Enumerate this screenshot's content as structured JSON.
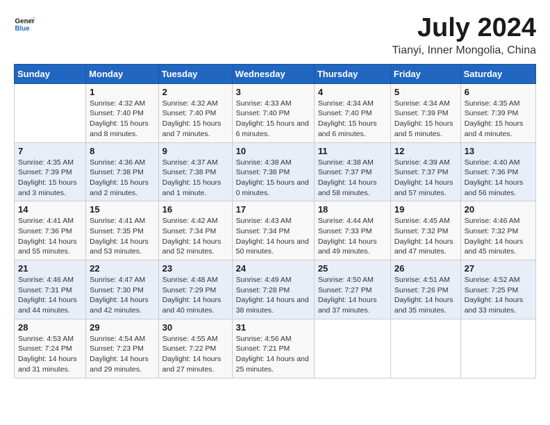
{
  "logo": {
    "line1": "General",
    "line2": "Blue"
  },
  "title": "July 2024",
  "subtitle": "Tianyi, Inner Mongolia, China",
  "headers": [
    "Sunday",
    "Monday",
    "Tuesday",
    "Wednesday",
    "Thursday",
    "Friday",
    "Saturday"
  ],
  "weeks": [
    [
      {
        "day": "",
        "sunrise": "",
        "sunset": "",
        "daylight": ""
      },
      {
        "day": "1",
        "sunrise": "Sunrise: 4:32 AM",
        "sunset": "Sunset: 7:40 PM",
        "daylight": "Daylight: 15 hours and 8 minutes."
      },
      {
        "day": "2",
        "sunrise": "Sunrise: 4:32 AM",
        "sunset": "Sunset: 7:40 PM",
        "daylight": "Daylight: 15 hours and 7 minutes."
      },
      {
        "day": "3",
        "sunrise": "Sunrise: 4:33 AM",
        "sunset": "Sunset: 7:40 PM",
        "daylight": "Daylight: 15 hours and 6 minutes."
      },
      {
        "day": "4",
        "sunrise": "Sunrise: 4:34 AM",
        "sunset": "Sunset: 7:40 PM",
        "daylight": "Daylight: 15 hours and 6 minutes."
      },
      {
        "day": "5",
        "sunrise": "Sunrise: 4:34 AM",
        "sunset": "Sunset: 7:39 PM",
        "daylight": "Daylight: 15 hours and 5 minutes."
      },
      {
        "day": "6",
        "sunrise": "Sunrise: 4:35 AM",
        "sunset": "Sunset: 7:39 PM",
        "daylight": "Daylight: 15 hours and 4 minutes."
      }
    ],
    [
      {
        "day": "7",
        "sunrise": "Sunrise: 4:35 AM",
        "sunset": "Sunset: 7:39 PM",
        "daylight": "Daylight: 15 hours and 3 minutes."
      },
      {
        "day": "8",
        "sunrise": "Sunrise: 4:36 AM",
        "sunset": "Sunset: 7:38 PM",
        "daylight": "Daylight: 15 hours and 2 minutes."
      },
      {
        "day": "9",
        "sunrise": "Sunrise: 4:37 AM",
        "sunset": "Sunset: 7:38 PM",
        "daylight": "Daylight: 15 hours and 1 minute."
      },
      {
        "day": "10",
        "sunrise": "Sunrise: 4:38 AM",
        "sunset": "Sunset: 7:38 PM",
        "daylight": "Daylight: 15 hours and 0 minutes."
      },
      {
        "day": "11",
        "sunrise": "Sunrise: 4:38 AM",
        "sunset": "Sunset: 7:37 PM",
        "daylight": "Daylight: 14 hours and 58 minutes."
      },
      {
        "day": "12",
        "sunrise": "Sunrise: 4:39 AM",
        "sunset": "Sunset: 7:37 PM",
        "daylight": "Daylight: 14 hours and 57 minutes."
      },
      {
        "day": "13",
        "sunrise": "Sunrise: 4:40 AM",
        "sunset": "Sunset: 7:36 PM",
        "daylight": "Daylight: 14 hours and 56 minutes."
      }
    ],
    [
      {
        "day": "14",
        "sunrise": "Sunrise: 4:41 AM",
        "sunset": "Sunset: 7:36 PM",
        "daylight": "Daylight: 14 hours and 55 minutes."
      },
      {
        "day": "15",
        "sunrise": "Sunrise: 4:41 AM",
        "sunset": "Sunset: 7:35 PM",
        "daylight": "Daylight: 14 hours and 53 minutes."
      },
      {
        "day": "16",
        "sunrise": "Sunrise: 4:42 AM",
        "sunset": "Sunset: 7:34 PM",
        "daylight": "Daylight: 14 hours and 52 minutes."
      },
      {
        "day": "17",
        "sunrise": "Sunrise: 4:43 AM",
        "sunset": "Sunset: 7:34 PM",
        "daylight": "Daylight: 14 hours and 50 minutes."
      },
      {
        "day": "18",
        "sunrise": "Sunrise: 4:44 AM",
        "sunset": "Sunset: 7:33 PM",
        "daylight": "Daylight: 14 hours and 49 minutes."
      },
      {
        "day": "19",
        "sunrise": "Sunrise: 4:45 AM",
        "sunset": "Sunset: 7:32 PM",
        "daylight": "Daylight: 14 hours and 47 minutes."
      },
      {
        "day": "20",
        "sunrise": "Sunrise: 4:46 AM",
        "sunset": "Sunset: 7:32 PM",
        "daylight": "Daylight: 14 hours and 45 minutes."
      }
    ],
    [
      {
        "day": "21",
        "sunrise": "Sunrise: 4:46 AM",
        "sunset": "Sunset: 7:31 PM",
        "daylight": "Daylight: 14 hours and 44 minutes."
      },
      {
        "day": "22",
        "sunrise": "Sunrise: 4:47 AM",
        "sunset": "Sunset: 7:30 PM",
        "daylight": "Daylight: 14 hours and 42 minutes."
      },
      {
        "day": "23",
        "sunrise": "Sunrise: 4:48 AM",
        "sunset": "Sunset: 7:29 PM",
        "daylight": "Daylight: 14 hours and 40 minutes."
      },
      {
        "day": "24",
        "sunrise": "Sunrise: 4:49 AM",
        "sunset": "Sunset: 7:28 PM",
        "daylight": "Daylight: 14 hours and 38 minutes."
      },
      {
        "day": "25",
        "sunrise": "Sunrise: 4:50 AM",
        "sunset": "Sunset: 7:27 PM",
        "daylight": "Daylight: 14 hours and 37 minutes."
      },
      {
        "day": "26",
        "sunrise": "Sunrise: 4:51 AM",
        "sunset": "Sunset: 7:26 PM",
        "daylight": "Daylight: 14 hours and 35 minutes."
      },
      {
        "day": "27",
        "sunrise": "Sunrise: 4:52 AM",
        "sunset": "Sunset: 7:25 PM",
        "daylight": "Daylight: 14 hours and 33 minutes."
      }
    ],
    [
      {
        "day": "28",
        "sunrise": "Sunrise: 4:53 AM",
        "sunset": "Sunset: 7:24 PM",
        "daylight": "Daylight: 14 hours and 31 minutes."
      },
      {
        "day": "29",
        "sunrise": "Sunrise: 4:54 AM",
        "sunset": "Sunset: 7:23 PM",
        "daylight": "Daylight: 14 hours and 29 minutes."
      },
      {
        "day": "30",
        "sunrise": "Sunrise: 4:55 AM",
        "sunset": "Sunset: 7:22 PM",
        "daylight": "Daylight: 14 hours and 27 minutes."
      },
      {
        "day": "31",
        "sunrise": "Sunrise: 4:56 AM",
        "sunset": "Sunset: 7:21 PM",
        "daylight": "Daylight: 14 hours and 25 minutes."
      },
      {
        "day": "",
        "sunrise": "",
        "sunset": "",
        "daylight": ""
      },
      {
        "day": "",
        "sunrise": "",
        "sunset": "",
        "daylight": ""
      },
      {
        "day": "",
        "sunrise": "",
        "sunset": "",
        "daylight": ""
      }
    ]
  ]
}
